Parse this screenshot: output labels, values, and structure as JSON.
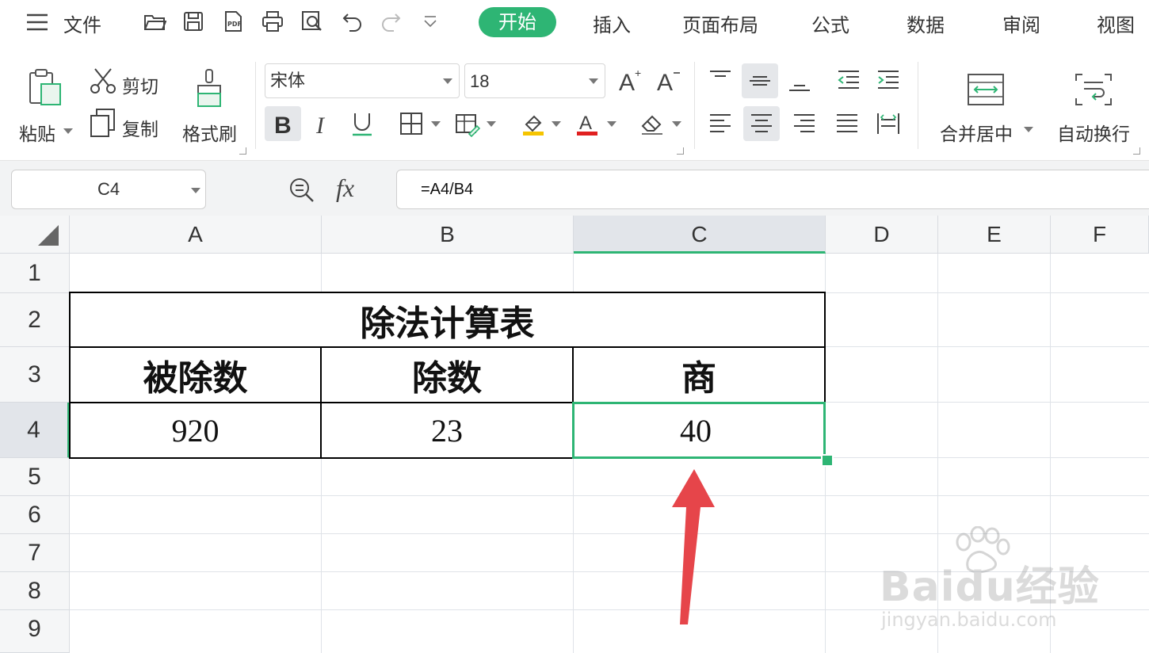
{
  "menu": {
    "file": "文件",
    "tabs": [
      "开始",
      "插入",
      "页面布局",
      "公式",
      "数据",
      "审阅",
      "视图"
    ]
  },
  "ribbon": {
    "paste": "粘贴",
    "cut": "剪切",
    "copy": "复制",
    "format_painter": "格式刷",
    "font_name": "宋体",
    "font_size": "18",
    "merge_center": "合并居中",
    "wrap_text": "自动换行",
    "accent_color": "#2eb574"
  },
  "formula_bar": {
    "name_box": "C4",
    "fx": "fx",
    "formula": "=A4/B4"
  },
  "sheet": {
    "columns": [
      "A",
      "B",
      "C",
      "D",
      "E",
      "F"
    ],
    "rows": [
      "1",
      "2",
      "3",
      "4",
      "5",
      "6",
      "7",
      "8",
      "9"
    ],
    "title": "除法计算表",
    "headers": [
      "被除数",
      "除数",
      "商"
    ],
    "values": [
      "920",
      "23",
      "40"
    ],
    "selected_cell": "C4"
  },
  "watermark": {
    "brand": "Baidu经验",
    "url": "jingyan.baidu.com"
  }
}
